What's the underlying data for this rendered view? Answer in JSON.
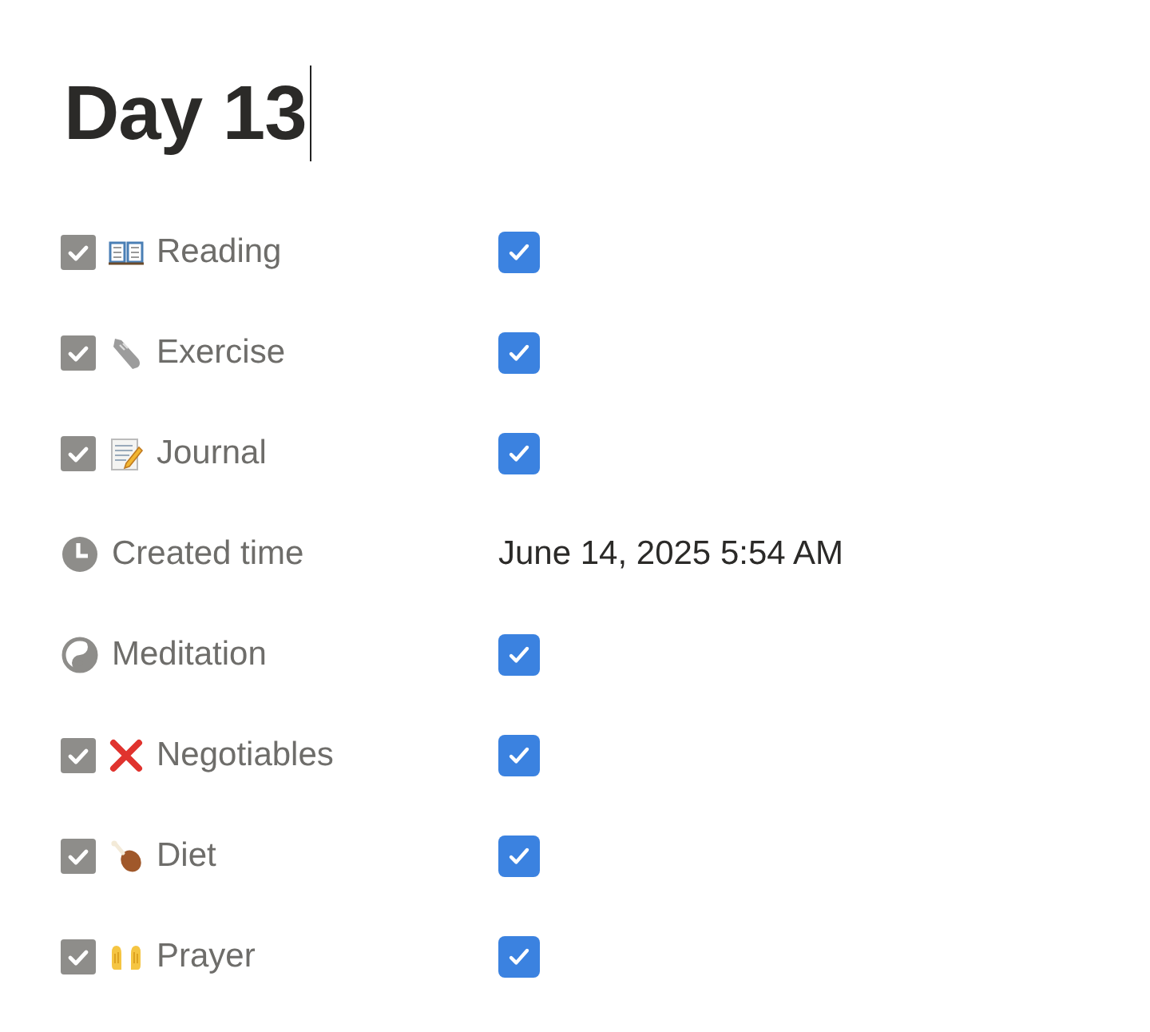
{
  "page": {
    "title": "Day 13"
  },
  "properties": [
    {
      "label": "Reading",
      "kind": "checkbox",
      "checked": true
    },
    {
      "label": "Exercise",
      "kind": "checkbox",
      "checked": true
    },
    {
      "label": "Journal",
      "kind": "checkbox",
      "checked": true
    },
    {
      "label": "Created time",
      "kind": "date",
      "value": "June 14, 2025 5:54 AM"
    },
    {
      "label": "Meditation",
      "kind": "checkbox",
      "checked": true
    },
    {
      "label": "Negotiables",
      "kind": "checkbox",
      "checked": true
    },
    {
      "label": "Diet",
      "kind": "checkbox",
      "checked": true
    },
    {
      "label": "Prayer",
      "kind": "checkbox",
      "checked": true
    }
  ]
}
